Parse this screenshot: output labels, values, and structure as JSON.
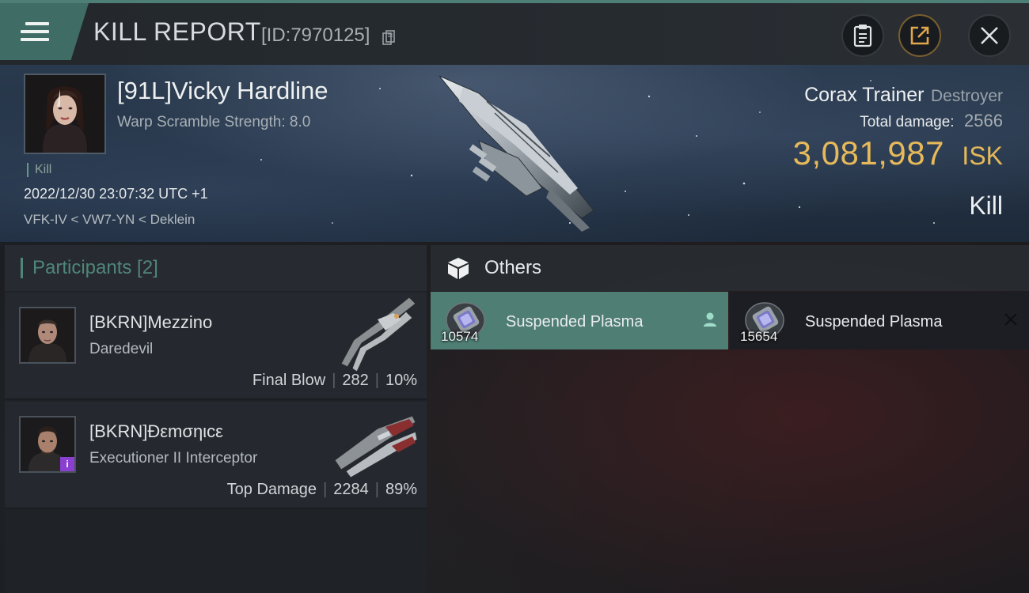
{
  "header": {
    "title": "KILL REPORT",
    "kill_id": "[ID:7970125]",
    "icons": [
      "menu-icon",
      "copy-icon",
      "clipboard-icon",
      "share-icon",
      "close-icon"
    ]
  },
  "victim": {
    "name": "[91L]Vicky Hardline",
    "warp_scramble": "Warp Scramble Strength: 8.0",
    "tag": "Kill",
    "datetime": "2022/12/30 23:07:32 UTC +1",
    "location": "VFK-IV < VW7-YN < Deklein",
    "ship_name": "Corax Trainer",
    "ship_class": "Destroyer",
    "total_damage_label": "Total damage:",
    "total_damage": "2566",
    "isk_value": "3,081,987",
    "isk_unit": "ISK",
    "result": "Kill"
  },
  "participants": {
    "title": "Participants [2]",
    "rows": [
      {
        "name": "[BKRN]Mezzino",
        "ship": "Daredevil",
        "role": "Final Blow",
        "damage": "282",
        "percent": "10%"
      },
      {
        "name": "[BKRN]Ðεmσηιcε",
        "ship": "Executioner II Interceptor",
        "role": "Top Damage",
        "damage": "2284",
        "percent": "89%",
        "badge": "i"
      }
    ]
  },
  "others": {
    "title": "Others",
    "items": [
      {
        "name": "Suspended Plasma",
        "qty": "10574",
        "selected": true,
        "action_icon": "person-icon"
      },
      {
        "name": "Suspended Plasma",
        "qty": "15654",
        "selected": false,
        "action_icon": "close-icon"
      }
    ]
  },
  "colors": {
    "accent": "#4f7e74",
    "isk": "#e6b95a",
    "badge": "#8a3fd1"
  }
}
